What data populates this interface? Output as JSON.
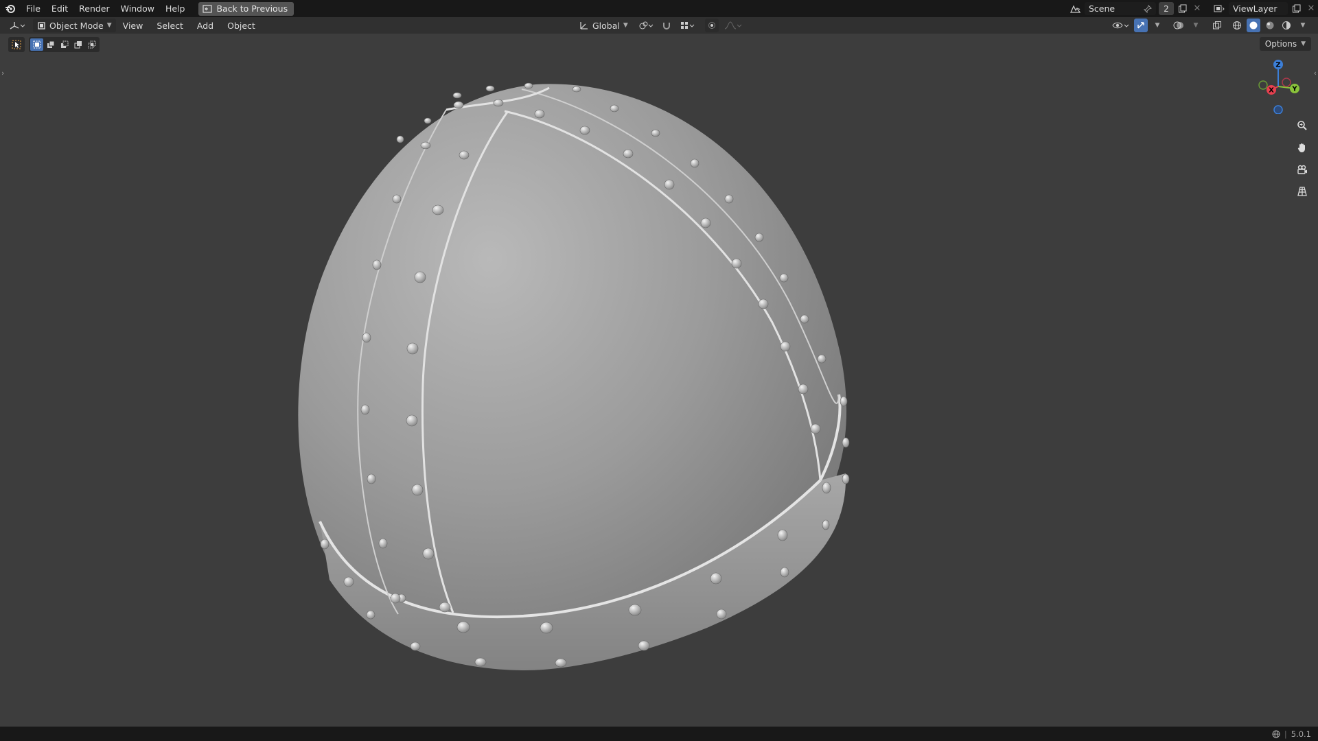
{
  "topbar": {
    "logo_icon": "blender-logo-icon",
    "menu": [
      "File",
      "Edit",
      "Render",
      "Window",
      "Help"
    ],
    "back_button": "Back to Previous",
    "scene_name": "Scene",
    "scene_users": "2",
    "view_layer": "ViewLayer"
  },
  "header": {
    "mode": "Object Mode",
    "menu": [
      "View",
      "Select",
      "Add",
      "Object"
    ],
    "transform_orientation": "Global"
  },
  "viewport": {
    "options_label": "Options",
    "gizmo_axes": [
      "Z",
      "Y",
      "X"
    ],
    "colors": {
      "x_axis": "#e8404f",
      "y_axis": "#8ac33b",
      "z_axis": "#3c7fd8",
      "active": "#4772b3"
    }
  },
  "statusbar": {
    "version": "5.0.1"
  }
}
